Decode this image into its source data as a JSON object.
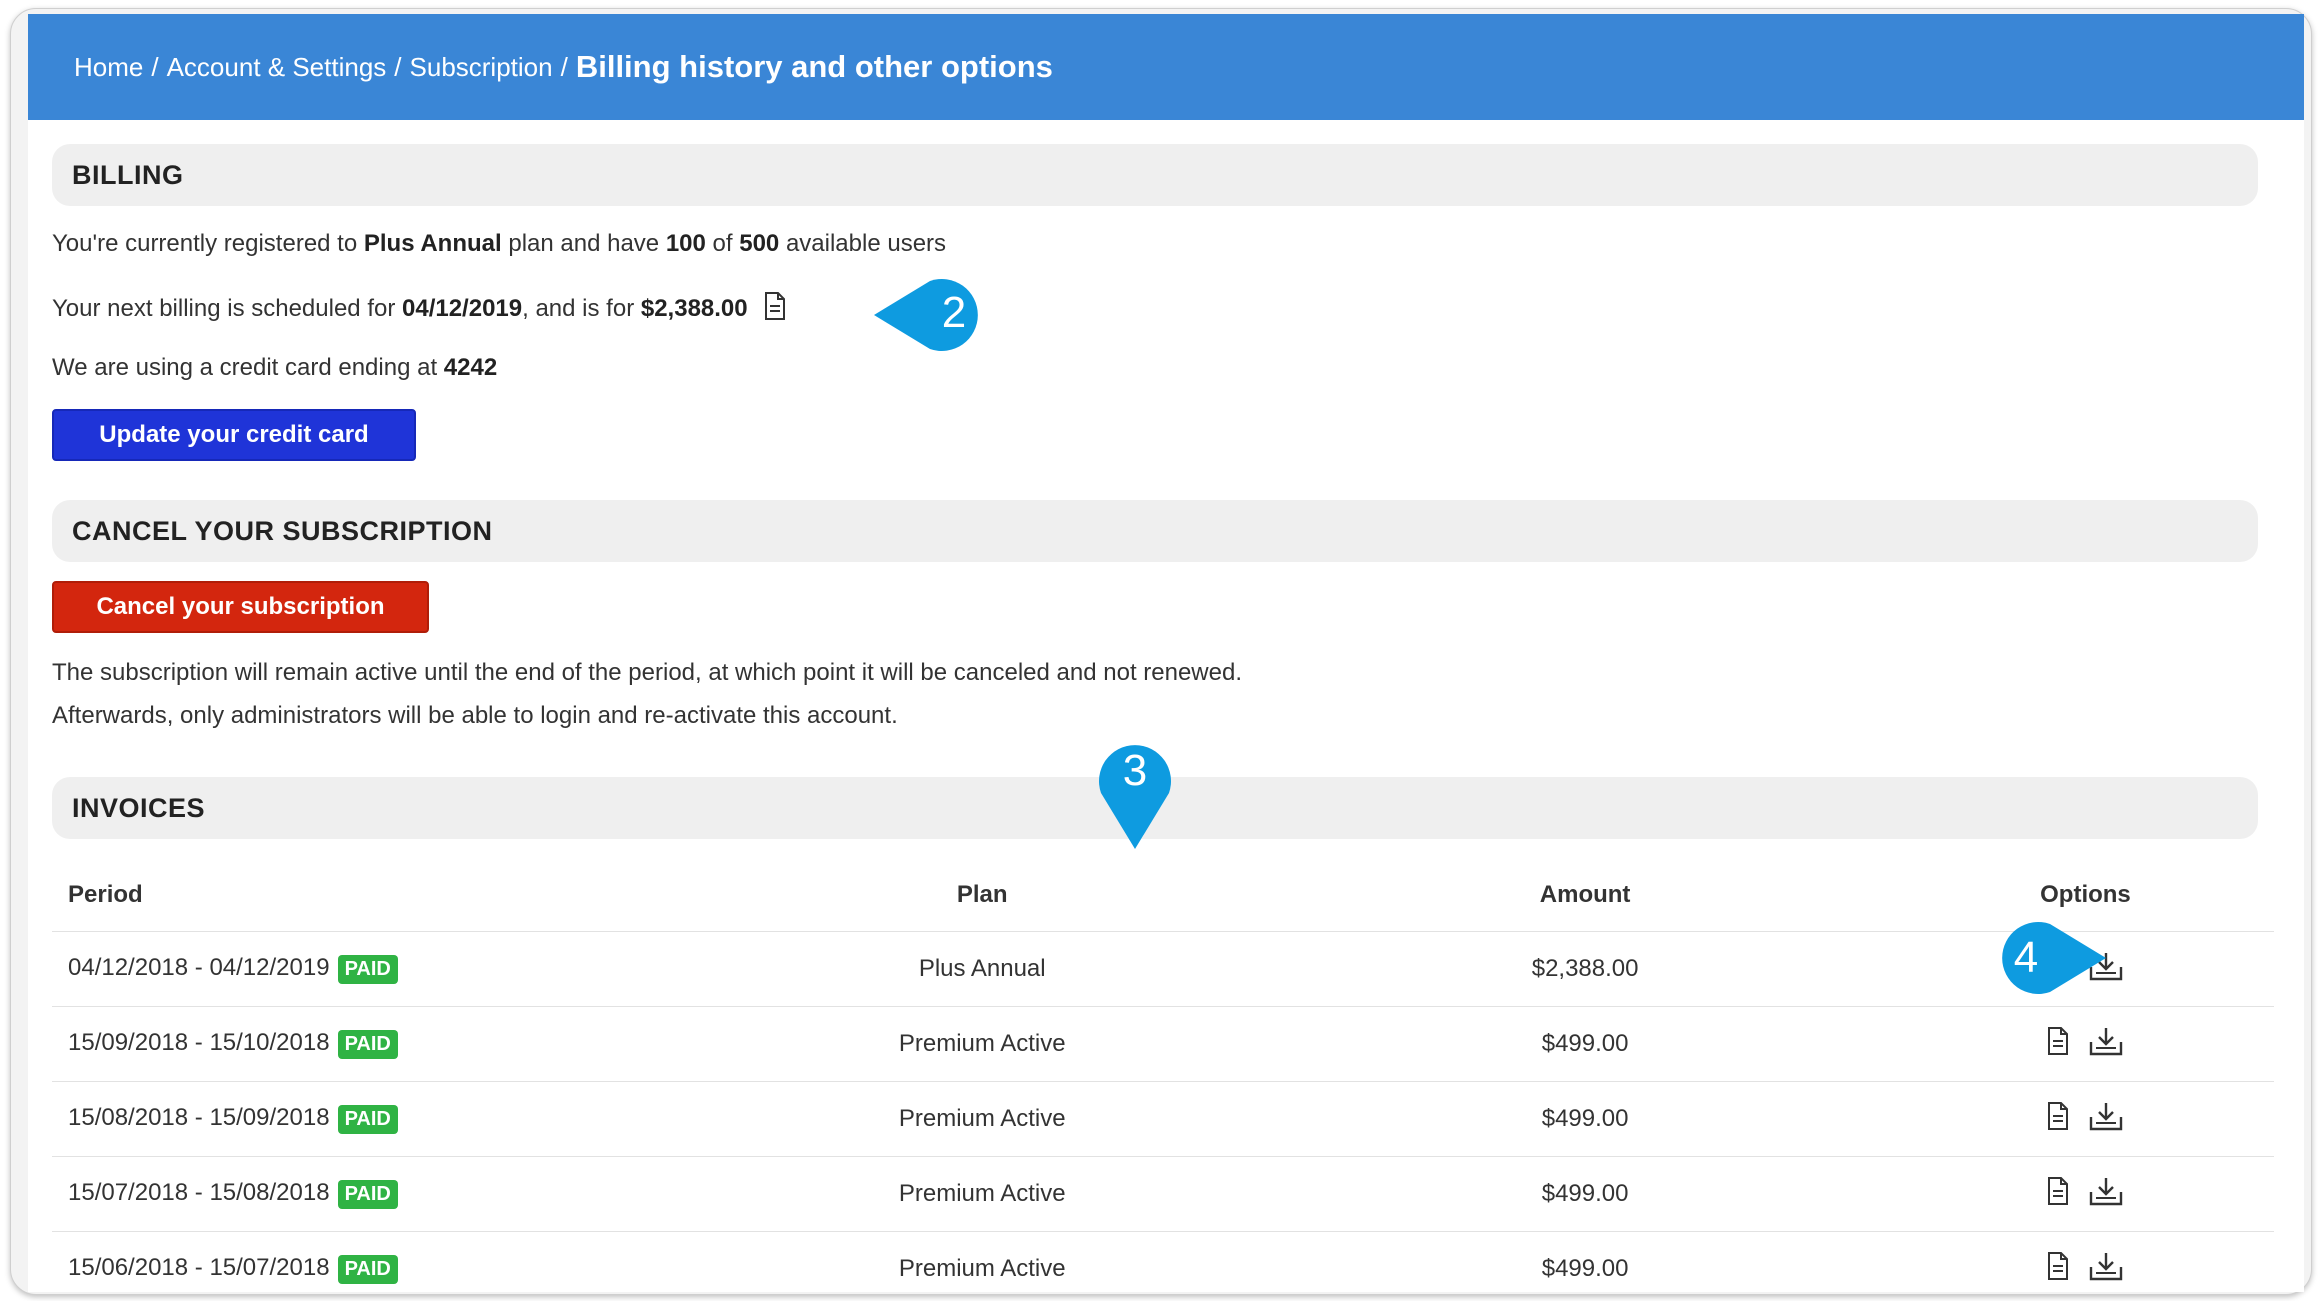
{
  "breadcrumb": {
    "items": [
      "Home",
      "Account & Settings",
      "Subscription"
    ],
    "current": "Billing history and other options",
    "separator": "/"
  },
  "billing": {
    "header": "BILLING",
    "line1": {
      "prefix": "You're currently registered to",
      "plan": "Plus Annual",
      "middle": "plan and have",
      "users": "100",
      "of": "of",
      "total": "500",
      "suffix": "available users"
    },
    "line2": {
      "prefix": "Your next billing is scheduled for",
      "date": "04/12/2019",
      "middle": ", and is for",
      "amount": "$2,388.00"
    },
    "line3": {
      "prefix": "We are using a credit card ending at",
      "last4": "4242"
    },
    "update_button": "Update your credit card"
  },
  "cancel": {
    "header": "CANCEL YOUR SUBSCRIPTION",
    "button": "Cancel your subscription",
    "note1": "The subscription will remain active until the end of the period, at which point it will be canceled and not renewed.",
    "note2": "Afterwards, only administrators will be able to login and re-activate this account."
  },
  "invoices": {
    "header": "INVOICES",
    "columns": {
      "period": "Period",
      "plan": "Plan",
      "amount": "Amount",
      "options": "Options"
    },
    "rows": [
      {
        "period": "04/12/2018 - 04/12/2019",
        "status": "PAID",
        "plan": "Plus Annual",
        "amount": "$2,388.00"
      },
      {
        "period": "15/09/2018 - 15/10/2018",
        "status": "PAID",
        "plan": "Premium Active",
        "amount": "$499.00"
      },
      {
        "period": "15/08/2018 - 15/09/2018",
        "status": "PAID",
        "plan": "Premium Active",
        "amount": "$499.00"
      },
      {
        "period": "15/07/2018 - 15/08/2018",
        "status": "PAID",
        "plan": "Premium Active",
        "amount": "$499.00"
      },
      {
        "period": "15/06/2018 - 15/07/2018",
        "status": "PAID",
        "plan": "Premium Active",
        "amount": "$499.00"
      }
    ]
  },
  "callouts": {
    "c2": "2",
    "c3": "3",
    "c4": "4"
  },
  "colors": {
    "header_bg": "#3a86d6",
    "blue_button": "#1f34d8",
    "red_button": "#d3260e",
    "paid_badge": "#2fb344",
    "callout": "#0e9be0"
  },
  "icons": {
    "invoice": "document-icon",
    "download": "download-icon"
  }
}
